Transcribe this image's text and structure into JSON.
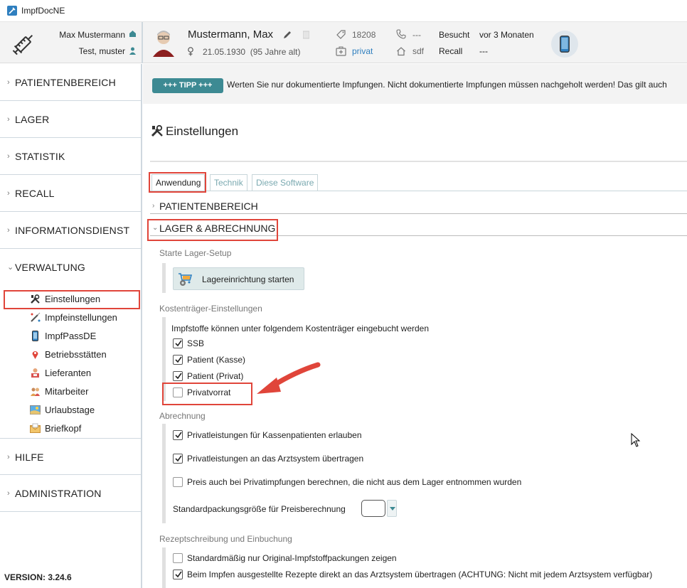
{
  "window": {
    "title": "ImpfDocNE"
  },
  "header": {
    "user_name": "Max Mustermann",
    "user_role": "Test, muster",
    "patient_name": "Mustermann, Max",
    "birth_date": "21.05.1930",
    "age": "(95 Jahre alt)",
    "insurer_no": "18208",
    "insurance_type": "privat",
    "phone": "---",
    "address": "sdf",
    "visited_label": "Besucht",
    "visited_value": "vor 3 Monaten",
    "recall_label": "Recall",
    "recall_value": "---",
    "icons": [
      "syringe-logo-icon",
      "house-icon",
      "person-icon",
      "avatar",
      "pencil-icon",
      "card-icon",
      "gender-icon",
      "tag-icon",
      "insurance-icon",
      "phone-icon",
      "home-icon",
      "mobile-device-icon"
    ]
  },
  "sidebar": {
    "sections": [
      {
        "label": "PATIENTENBEREICH"
      },
      {
        "label": "LAGER"
      },
      {
        "label": "STATISTIK"
      },
      {
        "label": "RECALL"
      },
      {
        "label": "INFORMATIONSDIENST"
      },
      {
        "label": "VERWALTUNG"
      },
      {
        "label": "HILFE"
      },
      {
        "label": "ADMINISTRATION"
      }
    ],
    "verwaltung_items": [
      {
        "label": "Einstellungen",
        "icon": "tools-icon"
      },
      {
        "label": "Impfeinstellungen",
        "icon": "syringe-icon"
      },
      {
        "label": "ImpfPassDE",
        "icon": "mobile-icon"
      },
      {
        "label": "Betriebsstätten",
        "icon": "map-pin-icon"
      },
      {
        "label": "Lieferanten",
        "icon": "supplier-icon"
      },
      {
        "label": "Mitarbeiter",
        "icon": "staff-icon"
      },
      {
        "label": "Urlaubstage",
        "icon": "vacation-icon"
      },
      {
        "label": "Briefkopf",
        "icon": "envelope-icon"
      }
    ],
    "version": "VERSION: 3.24.6"
  },
  "tip": {
    "badge": "+++ TIPP +++",
    "text": "Werten Sie nur dokumentierte Impfungen. Nicht dokumentierte Impfungen müssen nachgeholt werden! Das gilt auch"
  },
  "page": {
    "title": "Einstellungen",
    "tabs": [
      "Anwendung",
      "Technik",
      "Diese Software"
    ],
    "active_tab": "Anwendung"
  },
  "sections": {
    "patientenbereich": "PATIENTENBEREICH",
    "lager": "LAGER & ABRECHNUNG"
  },
  "lager": {
    "setup_label": "Starte Lager-Setup",
    "setup_button": "Lagereinrichtung starten",
    "kosten_label": "Kostenträger-Einstellungen",
    "kosten_text": "Impfstoffe können unter folgendem Kostenträger eingebucht werden",
    "kosten_options": [
      {
        "label": "SSB",
        "checked": true
      },
      {
        "label": "Patient (Kasse)",
        "checked": true
      },
      {
        "label": "Patient (Privat)",
        "checked": true
      },
      {
        "label": "Privatvorrat",
        "checked": false
      }
    ],
    "abrechnung_label": "Abrechnung",
    "abrechnung_options": [
      {
        "label": "Privatleistungen für Kassenpatienten erlauben",
        "checked": true
      },
      {
        "label": "Privatleistungen an das Arztsystem übertragen",
        "checked": true
      },
      {
        "label": "Preis auch bei Privatimpfungen berechnen, die nicht aus dem Lager entnommen wurden",
        "checked": false
      }
    ],
    "pack_size_label": "Standardpackungsgröße für Preisberechnung",
    "pack_size_value": "",
    "rezept_label": "Rezeptschreibung und Einbuchung",
    "rezept_options": [
      {
        "label": "Standardmäßig nur Original-Impfstoffpackungen zeigen",
        "checked": false
      },
      {
        "label": "Beim Impfen ausgestellte Rezepte direkt an das Arztsystem übertragen (ACHTUNG: Nicht mit jedem Arztsystem verfügbar)",
        "checked": true
      }
    ]
  },
  "colors": {
    "accent": "#3d8a93",
    "annotation_red": "#e0453a",
    "link_blue": "#2f7fbf"
  }
}
